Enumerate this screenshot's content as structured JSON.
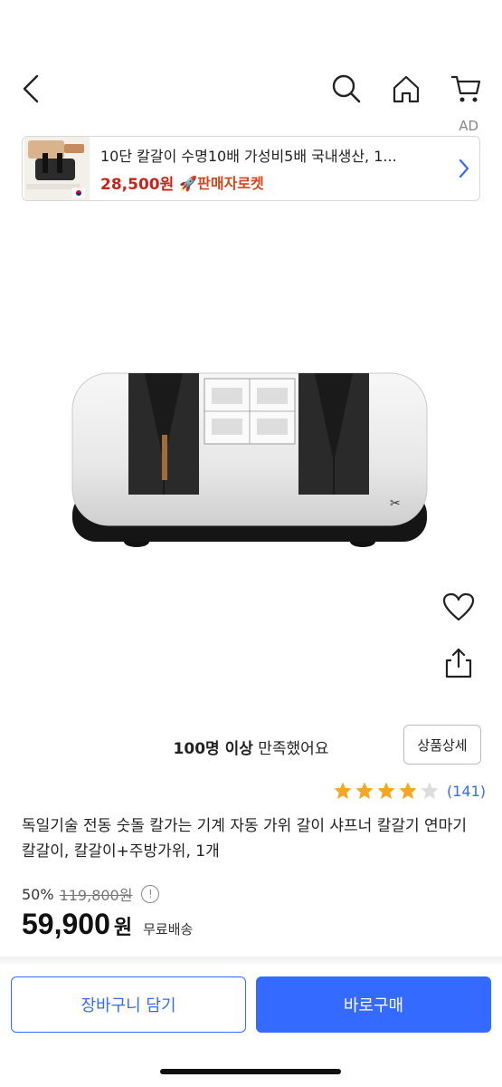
{
  "header": {
    "back_icon": "chevron-left-icon",
    "icons": [
      "search-icon",
      "home-icon",
      "cart-icon"
    ]
  },
  "ad": {
    "label": "AD",
    "title": "10단 칼갈이 수명10배 가성비5배 국내생산, 1...",
    "price": "28,500원",
    "badge": "🚀판매자로켓",
    "origin_flag": "korea-flag-icon"
  },
  "satisfaction": {
    "strong": "100명 이상",
    "rest": " 만족했어요"
  },
  "detail_button": "상품상세",
  "rating": {
    "stars": 4,
    "max": 5,
    "count": "(141)"
  },
  "product": {
    "title": "독일기술 전동 숫돌 칼가는 기계 자동 가위 갈이 샤프너 칼갈기 연마기 칼갈이, 칼갈이+주방가위, 1개",
    "discount_rate": "50%",
    "original_price": "119,800원",
    "sale_price": "59,900",
    "currency": "원",
    "shipping": "무료배송"
  },
  "actions": {
    "cart": "장바구니 담기",
    "buy": "바로구매"
  },
  "colors": {
    "accent": "#346aff",
    "price_red": "#c6251a",
    "star": "#f5a623"
  }
}
